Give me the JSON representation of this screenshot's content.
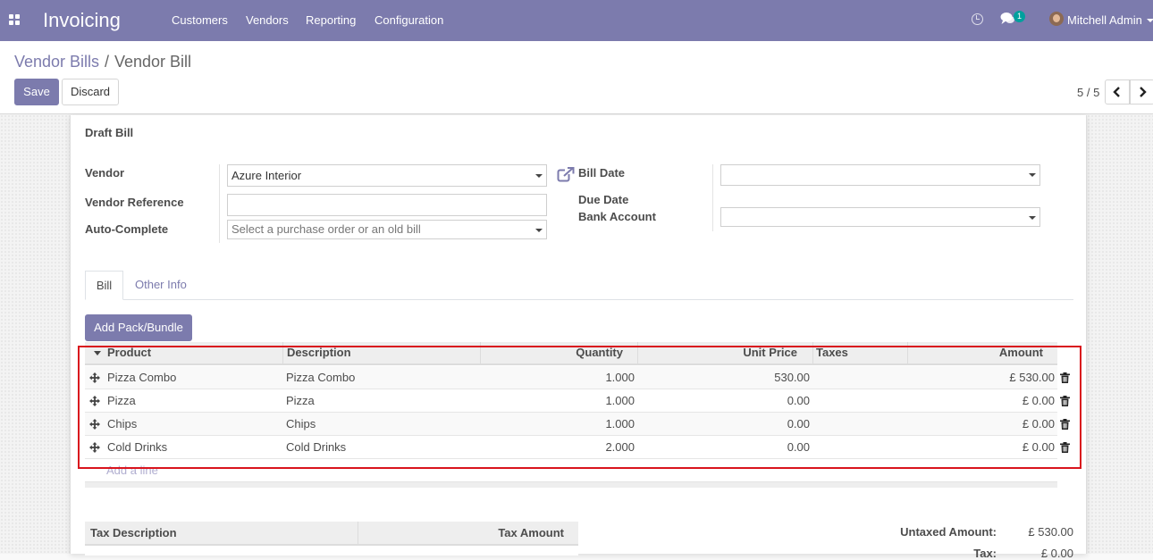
{
  "navbar": {
    "app_title": "Invoicing",
    "menu": [
      "Customers",
      "Vendors",
      "Reporting",
      "Configuration"
    ],
    "chat_badge": "1",
    "user_name": "Mitchell Admin",
    "bg_color": "#7c7bad"
  },
  "breadcrumb": {
    "parent": "Vendor Bills",
    "separator": "/",
    "current": "Vendor Bill"
  },
  "buttons": {
    "save": "Save",
    "discard": "Discard",
    "add_pack": "Add Pack/Bundle"
  },
  "pager": {
    "value": "5 / 5",
    "prev": "❮",
    "next": "❯"
  },
  "form": {
    "title": "Draft Bill",
    "vendor_label": "Vendor",
    "vendor_value": "Azure Interior",
    "vendor_ref_label": "Vendor Reference",
    "vendor_ref_value": "",
    "autocomplete_label": "Auto-Complete",
    "autocomplete_placeholder": "Select a purchase order or an old bill",
    "bill_date_label": "Bill Date",
    "bill_date_value": "",
    "due_date_label": "Due Date",
    "bank_account_label": "Bank Account",
    "bank_account_value": ""
  },
  "tabs": [
    {
      "label": "Bill",
      "active": true
    },
    {
      "label": "Other Info",
      "active": false
    }
  ],
  "lines": {
    "columns": [
      "Product",
      "Description",
      "Quantity",
      "Unit Price",
      "Taxes",
      "Amount"
    ],
    "rows": [
      {
        "product": "Pizza Combo",
        "description": "Pizza Combo",
        "quantity": "1.000",
        "unit_price": "530.00",
        "taxes": "",
        "amount": "£ 530.00"
      },
      {
        "product": "Pizza",
        "description": "Pizza",
        "quantity": "1.000",
        "unit_price": "0.00",
        "taxes": "",
        "amount": "£ 0.00"
      },
      {
        "product": "Chips",
        "description": "Chips",
        "quantity": "1.000",
        "unit_price": "0.00",
        "taxes": "",
        "amount": "£ 0.00"
      },
      {
        "product": "Cold Drinks",
        "description": "Cold Drinks",
        "quantity": "2.000",
        "unit_price": "0.00",
        "taxes": "",
        "amount": "£ 0.00"
      }
    ],
    "add_line": "Add a line"
  },
  "tax_table": {
    "columns": [
      "Tax Description",
      "Tax Amount"
    ]
  },
  "totals": {
    "untaxed_label": "Untaxed Amount:",
    "untaxed_value": "£ 530.00",
    "tax_label": "Tax:",
    "tax_value": "£ 0.00"
  },
  "colors": {
    "accent": "#7c7bad",
    "highlight": "#d9141d",
    "badge": "#00a09d"
  }
}
